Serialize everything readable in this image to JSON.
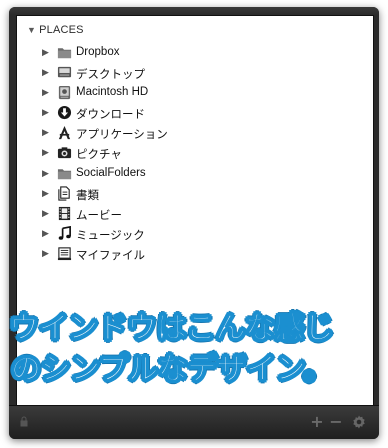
{
  "places": {
    "header": "PLACES",
    "items": [
      {
        "label": "Dropbox",
        "icon": "folder-icon"
      },
      {
        "label": "デスクトップ",
        "icon": "desktop-icon"
      },
      {
        "label": "Macintosh HD",
        "icon": "hard-drive-icon"
      },
      {
        "label": "ダウンロード",
        "icon": "download-icon"
      },
      {
        "label": "アプリケーション",
        "icon": "applications-icon"
      },
      {
        "label": "ピクチャ",
        "icon": "camera-icon"
      },
      {
        "label": "SocialFolders",
        "icon": "folder-icon"
      },
      {
        "label": "書類",
        "icon": "documents-icon"
      },
      {
        "label": "ムービー",
        "icon": "film-icon"
      },
      {
        "label": "ミュージック",
        "icon": "music-icon"
      },
      {
        "label": "マイファイル",
        "icon": "all-files-icon"
      }
    ]
  },
  "caption": {
    "line1": "ウインドウはこんな感じ",
    "line2": "のシンプルなデザイン。"
  },
  "toolbar": {
    "add_label": "+",
    "remove_label": "−",
    "settings_icon": "gear-icon",
    "lock_icon": "lock-icon"
  },
  "colors": {
    "window_bg": "#2b2b2b",
    "pane_bg": "#ffffff",
    "caption_outline": "#1b8fd0",
    "caption_fill": "#ffffff"
  }
}
